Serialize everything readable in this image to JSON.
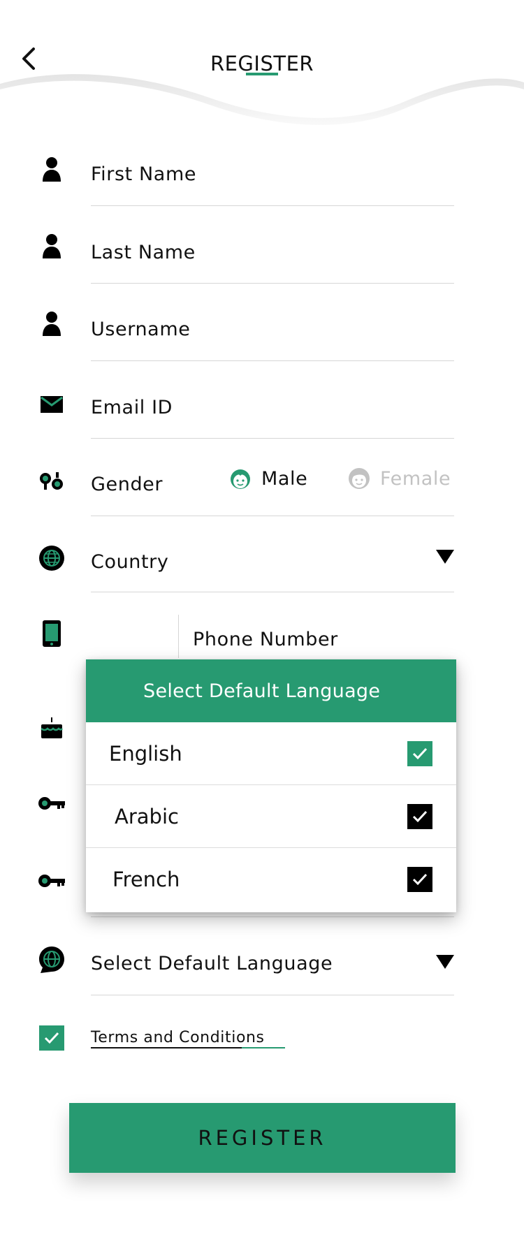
{
  "header": {
    "title": "REGISTER",
    "back_icon": "chevron-left-icon"
  },
  "form": {
    "first_name": "First Name",
    "last_name": "Last Name",
    "username": "Username",
    "email": "Email ID",
    "gender": {
      "label": "Gender",
      "options": [
        "Male",
        "Female"
      ],
      "selected": "Male"
    },
    "country": "Country",
    "phone": "Phone Number",
    "default_language": "Select Default Language"
  },
  "dialog": {
    "title": "Select Default Language",
    "options": [
      {
        "label": "English",
        "checked": true,
        "style": "green"
      },
      {
        "label": "Arabic",
        "checked": true,
        "style": "black"
      },
      {
        "label": "French",
        "checked": true,
        "style": "black"
      }
    ]
  },
  "terms": {
    "label": "Terms and Conditions",
    "checked": true
  },
  "register_button": "REGISTER",
  "colors": {
    "accent": "#279a71",
    "text": "#111111",
    "muted": "#c2c2c2",
    "divider": "#d6d6d6"
  }
}
